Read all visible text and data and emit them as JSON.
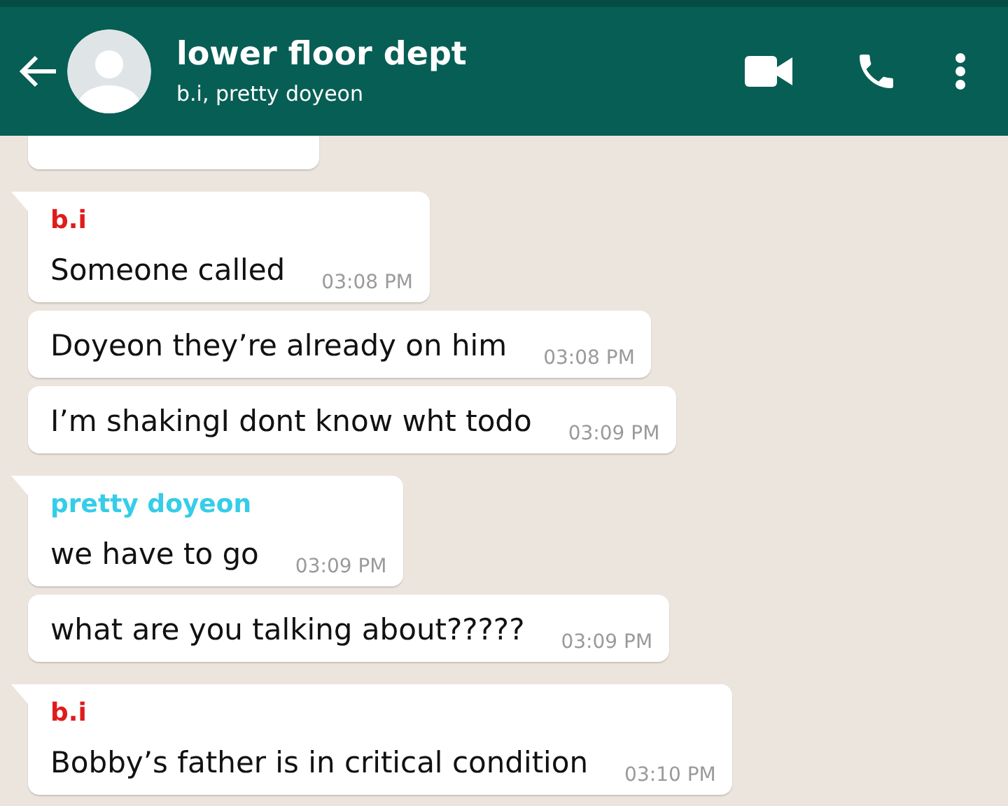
{
  "header": {
    "title": "lower floor dept",
    "subtitle": "b.i, pretty doyeon"
  },
  "messages": [
    {
      "sender": "b.i",
      "color": "#e01b1b",
      "text": "Someone called",
      "time": "03:08 PM"
    },
    {
      "text": "Doyeon they’re already on him",
      "time": "03:08 PM"
    },
    {
      "text": "I’m shakingI dont know wht todo",
      "time": "03:09 PM"
    },
    {
      "sender": "pretty doyeon",
      "color": "#35cde8",
      "text": "we have to go",
      "time": "03:09 PM"
    },
    {
      "text": "what are you talking about?????",
      "time": "03:09 PM"
    },
    {
      "sender": "b.i",
      "color": "#e01b1b",
      "text": "Bobby’s father is in critical condition",
      "time": "03:10 PM"
    }
  ]
}
